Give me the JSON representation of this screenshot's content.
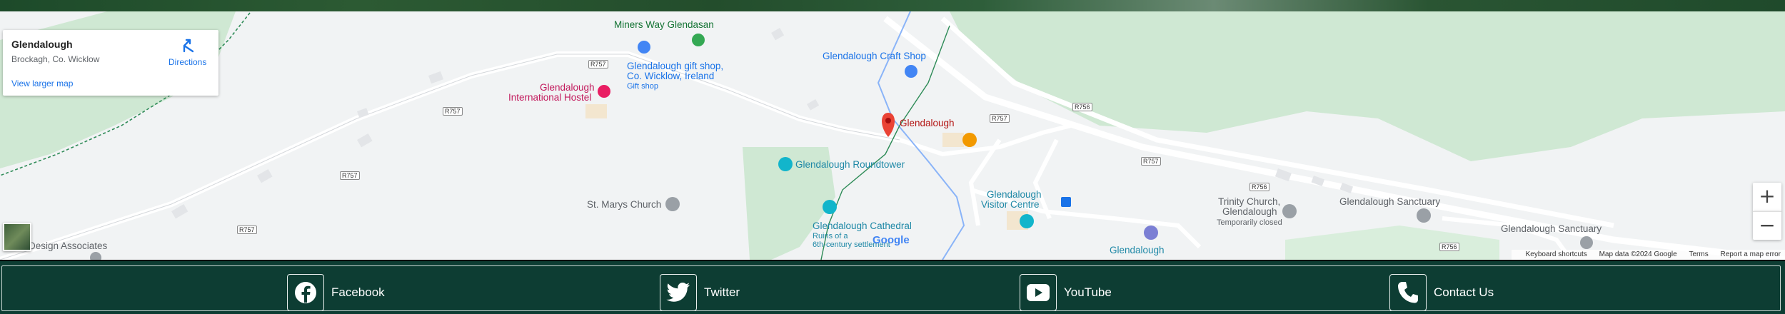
{
  "infocard": {
    "name": "Glendalough",
    "address": "Brockagh, Co. Wicklow",
    "directions_label": "Directions",
    "view_larger": "View larger map"
  },
  "places": {
    "miners_way": "Miners Way Glendasan",
    "craft_shop": "Glendalough Craft Shop",
    "gift_shop_line1": "Glendalough gift shop,",
    "gift_shop_line2": "Co. Wicklow, Ireland",
    "gift_shop_sub": "Gift shop",
    "hostel_line1": "Glendalough",
    "hostel_line2": "International Hostel",
    "glendalough_pin": "Glendalough",
    "roundtower": "Glendalough Roundtower",
    "st_marys": "St. Marys Church",
    "cathedral": "Glendalough Cathedral",
    "cathedral_sub1": "Ruins of a",
    "cathedral_sub2": "6th-century settlement",
    "visitor_line1": "Glendalough",
    "visitor_line2": "Visitor Centre",
    "trinity_line1": "Trinity Church,",
    "trinity_line2": "Glendalough",
    "trinity_sub": "Temporarily closed",
    "sanctuary1": "Glendalough Sanctuary",
    "sanctuary2": "Glendalough Sanctuary",
    "bottom_glendalough": "Glendalough",
    "design_associates": "Design Associates"
  },
  "roads": {
    "r757": "R757",
    "r756": "R756"
  },
  "attribution": {
    "google": "Google",
    "shortcuts": "Keyboard shortcuts",
    "mapdata": "Map data ©2024 Google",
    "terms": "Terms",
    "report": "Report a map error"
  },
  "zoom": {
    "in": "+",
    "out": "−"
  },
  "footer": {
    "facebook": "Facebook",
    "twitter": "Twitter",
    "youtube": "YouTube",
    "contact": "Contact Us"
  },
  "colors": {
    "footer_bg": "#0d3d33",
    "map_bg": "#f1f3f4",
    "park_green": "#cfe8d3",
    "pin_red": "#ea4335",
    "teal_poi": "#1e88a6"
  }
}
